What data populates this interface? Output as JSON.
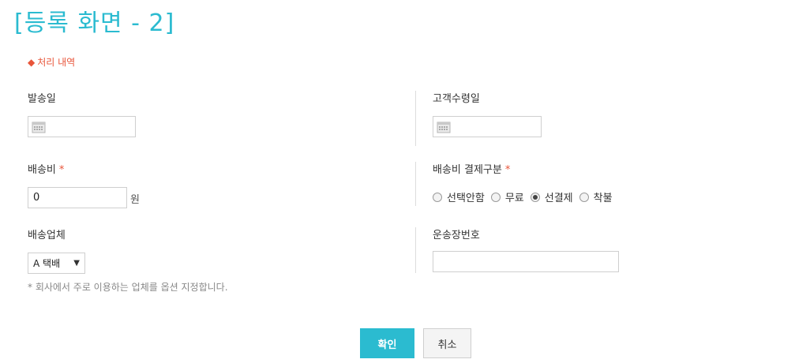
{
  "page_title": "[등록 화면 - 2]",
  "section": {
    "icon": "diamond-icon",
    "title": "처리 내역",
    "accent": "#e8553a"
  },
  "fields": {
    "ship_date": {
      "label": "발송일",
      "value": ""
    },
    "receive_date": {
      "label": "고객수령일",
      "value": ""
    },
    "shipping_fee": {
      "label": "배송비",
      "required_mark": "*",
      "value": "0",
      "unit": "원"
    },
    "payment_type": {
      "label": "배송비 결제구분",
      "required_mark": "*",
      "options": [
        "선택안함",
        "무료",
        "선결제",
        "착불"
      ],
      "selected": "선결제"
    },
    "carrier": {
      "label": "배송업체",
      "selected": "A 택배",
      "arrow": "▼",
      "note": "* 회사에서 주로 이용하는 업체를 옵션 지정합니다."
    },
    "tracking_no": {
      "label": "운송장번호",
      "value": ""
    }
  },
  "buttons": {
    "confirm": "확인",
    "cancel": "취소"
  },
  "colors": {
    "primary": "#2bbbd0",
    "required": "#e8553a"
  }
}
